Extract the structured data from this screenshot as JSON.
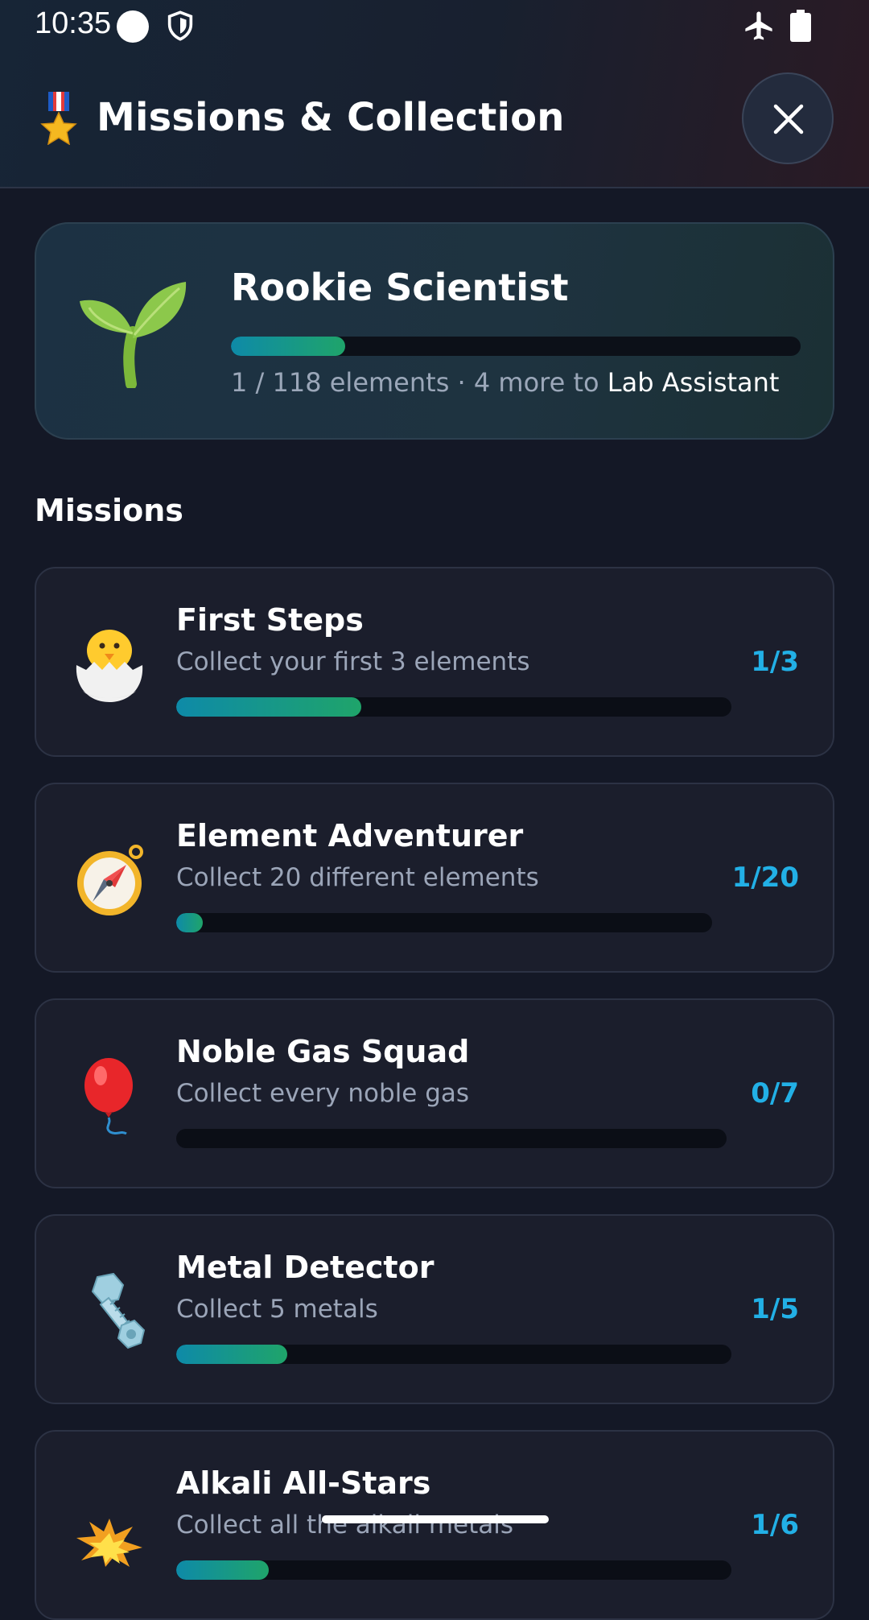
{
  "status_bar": {
    "time": "10:35"
  },
  "header": {
    "title": "Missions & Collection"
  },
  "rank": {
    "title": "Rookie Scientist",
    "progress_text": "1 / 118 elements · 4 more to ",
    "next_rank": "Lab Assistant",
    "progress_fraction": 0.2
  },
  "missions_heading": "Missions",
  "missions": [
    {
      "title": "First Steps",
      "desc": "Collect your first 3 elements",
      "count": "1/3",
      "progress": 0.333,
      "icon": "hatching-chick-icon"
    },
    {
      "title": "Element Adventurer",
      "desc": "Collect 20 different elements",
      "count": "1/20",
      "progress": 0.05,
      "icon": "compass-icon"
    },
    {
      "title": "Noble Gas Squad",
      "desc": "Collect every noble gas",
      "count": "0/7",
      "progress": 0,
      "icon": "balloon-icon"
    },
    {
      "title": "Metal Detector",
      "desc": "Collect 5 metals",
      "count": "1/5",
      "progress": 0.2,
      "icon": "bolt-nut-icon"
    },
    {
      "title": "Alkali All-Stars",
      "desc": "Collect all the alkali metals",
      "count": "1/6",
      "progress": 0.167,
      "icon": "explosion-icon"
    }
  ],
  "colors": {
    "accent": "#22b0e6",
    "background": "#141826",
    "card": "#1b1e2c",
    "progress_start": "#0e8aa8",
    "progress_end": "#1fa46a"
  }
}
